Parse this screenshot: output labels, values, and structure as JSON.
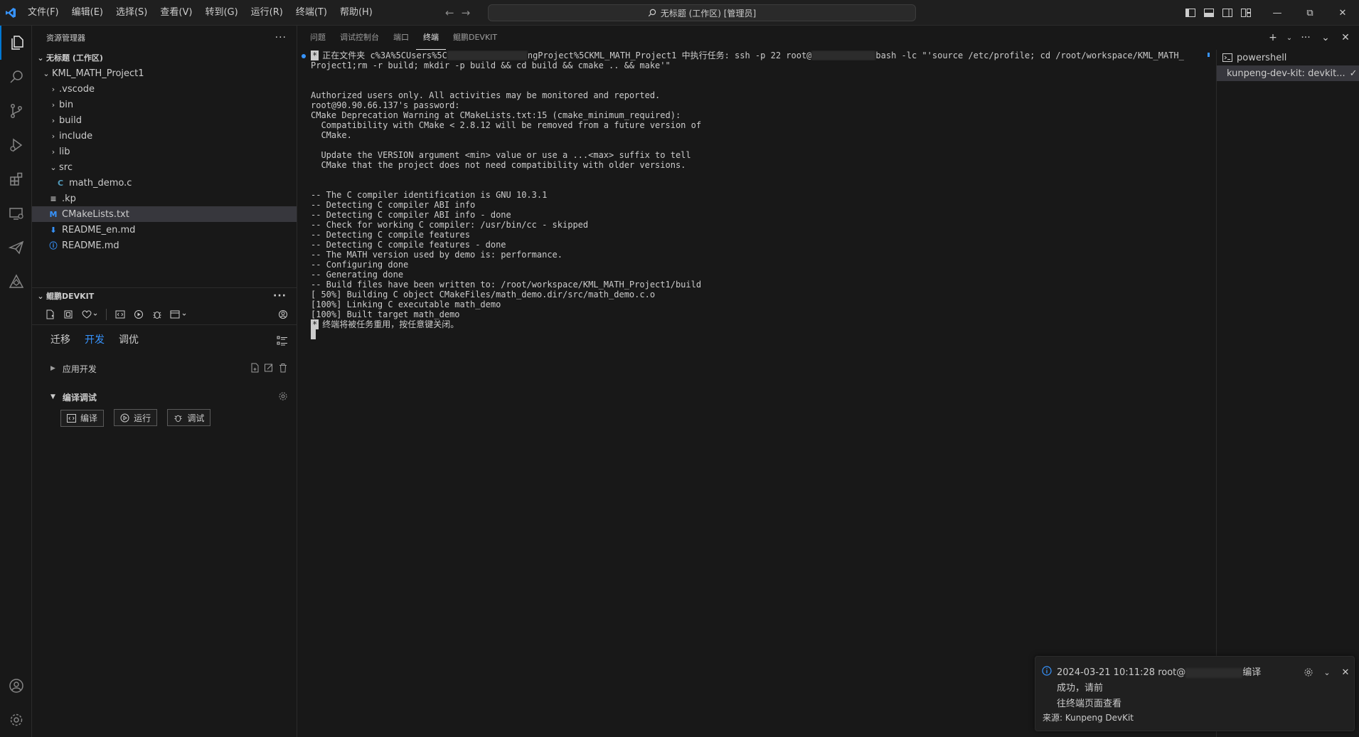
{
  "menu": [
    "文件(F)",
    "编辑(E)",
    "选择(S)",
    "查看(V)",
    "转到(G)",
    "运行(R)",
    "终端(T)",
    "帮助(H)"
  ],
  "command_center": "无标题 (工作区) [管理员]",
  "explorer": {
    "header": "资源管理器",
    "workspace": "无标题 (工作区)",
    "project": "KML_MATH_Project1",
    "items": [
      {
        "label": ".vscode",
        "type": "folder"
      },
      {
        "label": "bin",
        "type": "folder"
      },
      {
        "label": "build",
        "type": "folder"
      },
      {
        "label": "include",
        "type": "folder"
      },
      {
        "label": "lib",
        "type": "folder"
      },
      {
        "label": "src",
        "type": "folder-open"
      },
      {
        "label": "math_demo.c",
        "type": "c-file"
      },
      {
        "label": ".kp",
        "type": "lines-file"
      },
      {
        "label": "CMakeLists.txt",
        "type": "cmake-file"
      },
      {
        "label": "README_en.md",
        "type": "download-file"
      },
      {
        "label": "README.md",
        "type": "info-file"
      }
    ]
  },
  "devkit": {
    "header": "鲲鹏DEVKIT",
    "tabs": [
      "迁移",
      "开发",
      "调优"
    ],
    "active_tab": "开发",
    "group_app": "应用开发",
    "group_build": "编译调试",
    "buttons": {
      "compile": "编译",
      "run": "运行",
      "debug": "调试"
    }
  },
  "panel": {
    "tabs": [
      "问题",
      "调试控制台",
      "端口",
      "终端",
      "鲲鹏DEVKIT"
    ],
    "active_tab": "终端"
  },
  "terminal": {
    "task_line1_a": "正在文件夹 c%3A%5CUsers%5C",
    "task_line1_b": "ngProject%5CKML_MATH_Project1 中执行任务: ssh -p 22 root@",
    "task_line1_c": "bash -lc \"'source /etc/profile; cd /root/workspace/KML_MATH_",
    "task_line2": "Project1;rm -r build; mkdir -p build && cd build && cmake .. && make'\"",
    "lines": [
      "Authorized users only. All activities may be monitored and reported.",
      "root@90.90.66.137's password:",
      "CMake Deprecation Warning at CMakeLists.txt:15 (cmake_minimum_required):",
      "  Compatibility with CMake < 2.8.12 will be removed from a future version of",
      "  CMake.",
      "",
      "  Update the VERSION argument <min> value or use a ...<max> suffix to tell",
      "  CMake that the project does not need compatibility with older versions.",
      "",
      "",
      "-- The C compiler identification is GNU 10.3.1",
      "-- Detecting C compiler ABI info",
      "-- Detecting C compiler ABI info - done",
      "-- Check for working C compiler: /usr/bin/cc - skipped",
      "-- Detecting C compile features",
      "-- Detecting C compile features - done",
      "-- The MATH version used by demo is: performance.",
      "-- Configuring done",
      "-- Generating done",
      "-- Build files have been written to: /root/workspace/KML_MATH_Project1/build",
      "[ 50%] Building C object CMakeFiles/math_demo.dir/src/math_demo.c.o",
      "[100%] Linking C executable math_demo",
      "[100%] Built target math_demo"
    ],
    "reuse_msg": "终端将被任务重用，按任意键关闭。",
    "task_star": "*"
  },
  "terminal_list": [
    {
      "label": "powershell",
      "icon": "terminal-icon"
    },
    {
      "label": "kunpeng-dev-kit: devkit...",
      "icon": "tools-icon"
    }
  ],
  "notification": {
    "line1_a": "2024-03-21 10:11:28 root@",
    "line1_b": "编译成功，请前",
    "line2": "往终端页面查看",
    "source": "来源: Kunpeng DevKit"
  },
  "colors": {
    "accent": "#0078d4",
    "active_tab": "#3794ff",
    "c_file": "#519aba",
    "cmake": "#3794ff",
    "info": "#3794ff"
  }
}
